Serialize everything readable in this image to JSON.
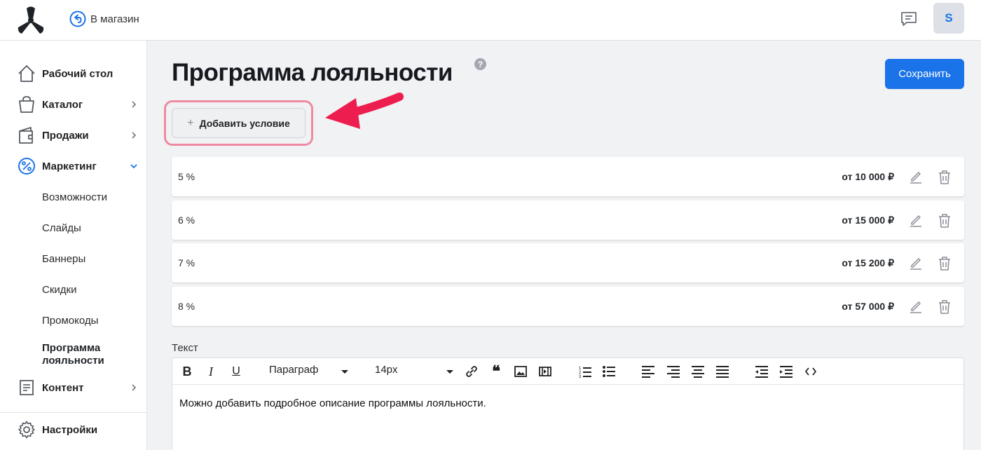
{
  "header": {
    "back_label": "В магазин",
    "avatar_letter": "S"
  },
  "sidebar": {
    "items": [
      {
        "label": "Рабочий стол",
        "icon": "home-icon"
      },
      {
        "label": "Каталог",
        "icon": "bag-icon"
      },
      {
        "label": "Продажи",
        "icon": "wallet-icon"
      },
      {
        "label": "Маркетинг",
        "icon": "percent-icon"
      },
      {
        "label": "Контент",
        "icon": "document-icon"
      },
      {
        "label": "Настройки",
        "icon": "gear-icon"
      }
    ],
    "marketing_sub": [
      "Возможности",
      "Слайды",
      "Баннеры",
      "Скидки",
      "Промокоды",
      "Программа лояльности"
    ]
  },
  "main": {
    "title": "Программа лояльности",
    "help": "?",
    "save_label": "Сохранить",
    "add_condition_label": "Добавить условие",
    "rules": [
      {
        "percent": "5 %",
        "threshold": "от 10 000 ₽"
      },
      {
        "percent": "6 %",
        "threshold": "от 15 000 ₽"
      },
      {
        "percent": "7 %",
        "threshold": "от 15 200 ₽"
      },
      {
        "percent": "8 %",
        "threshold": "от 57 000 ₽"
      }
    ],
    "text_label": "Текст",
    "editor": {
      "format_select": "Параграф",
      "size_select": "14px",
      "content": "Можно добавить подробное описание программы лояльности."
    }
  },
  "colors": {
    "accent": "#1a73e8",
    "highlight": "#ef8aa3",
    "arrow": "#ee1d4f"
  }
}
